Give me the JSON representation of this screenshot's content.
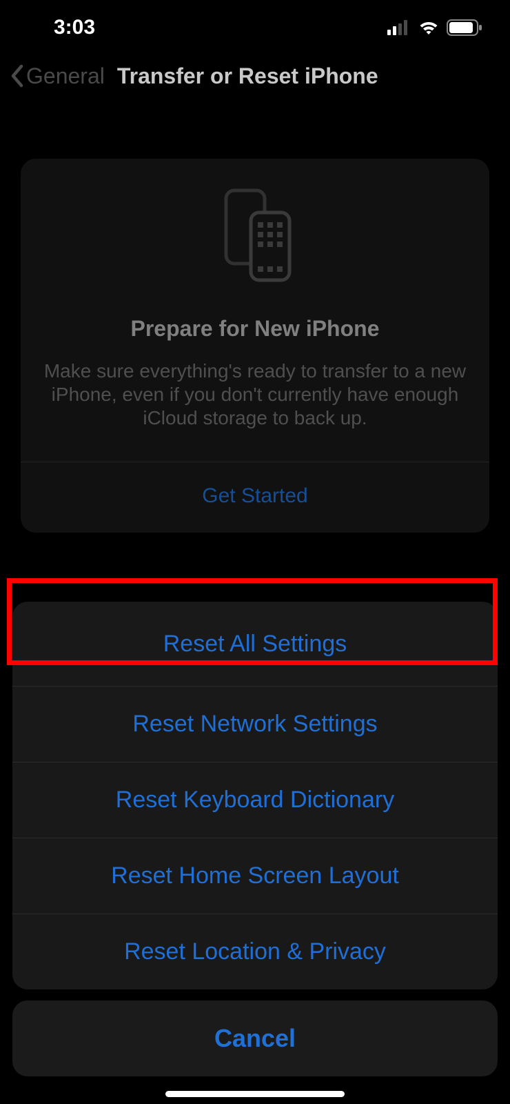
{
  "status": {
    "time": "3:03"
  },
  "nav": {
    "back_label": "General",
    "title": "Transfer or Reset iPhone"
  },
  "card": {
    "title": "Prepare for New iPhone",
    "description": "Make sure everything's ready to transfer to a new iPhone, even if you don't currently have enough iCloud storage to back up.",
    "action_label": "Get Started"
  },
  "sheet": {
    "items": [
      "Reset All Settings",
      "Reset Network Settings",
      "Reset Keyboard Dictionary",
      "Reset Home Screen Layout",
      "Reset Location & Privacy"
    ],
    "cancel_label": "Cancel"
  },
  "annotation": {
    "highlight_index": 0
  }
}
